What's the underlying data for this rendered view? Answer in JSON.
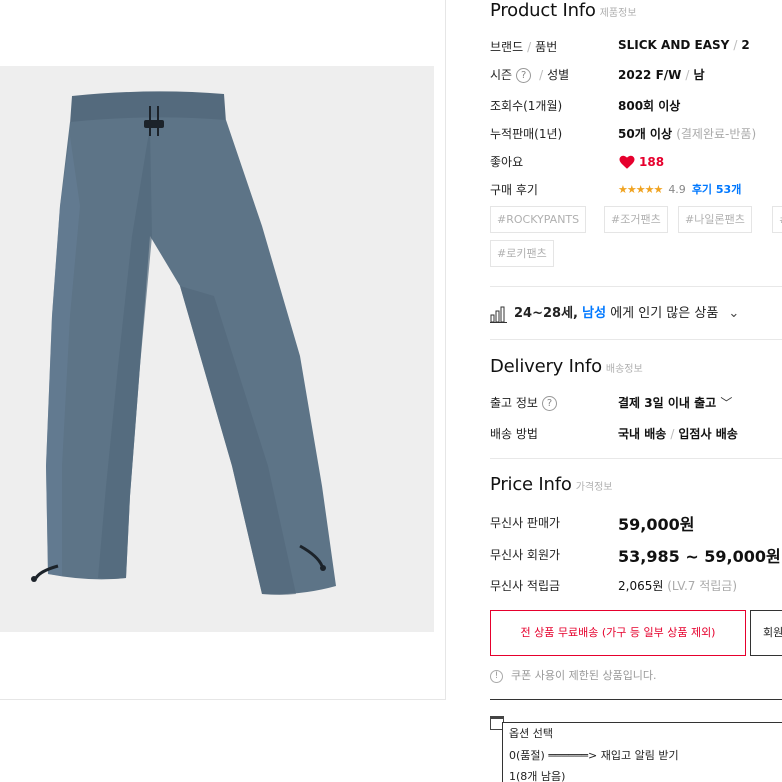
{
  "product_info": {
    "title": "Product Info",
    "subtitle": "제품정보",
    "brand_label": "브랜드",
    "model_label": "품번",
    "brand": "SLICK AND EASY",
    "model": "2",
    "season_label": "시즌",
    "gender_label": "성별",
    "season": "2022 F/W",
    "gender": "남",
    "views_label": "조회수(1개월)",
    "views": "800회 이상",
    "sales_label": "누적판매(1년)",
    "sales": "50개 이상",
    "sales_note": "(결제완료-반품)",
    "likes_label": "좋아요",
    "likes": "188",
    "reviews_label": "구매 후기",
    "stars": "★★★★★",
    "rating": "4.9",
    "review_count": "후기 53개"
  },
  "tags": [
    "#ROCKYPANTS",
    "#조거팬츠",
    "#나일론팬츠",
    "#",
    "#로키팬츠"
  ],
  "popular": {
    "age": "24~28세",
    "comma": ",",
    "gender": "남성",
    "text": "에게 인기 많은 상품"
  },
  "delivery_info": {
    "title": "Delivery Info",
    "subtitle": "배송정보",
    "shipping_label": "출고 정보",
    "shipping_value": "결제 3일 이내 출고",
    "method_label": "배송 방법",
    "method_domestic": "국내 배송",
    "method_vendor": "입점사 배송"
  },
  "price_info": {
    "title": "Price Info",
    "subtitle": "가격정보",
    "sale_label": "무신사 판매가",
    "sale_price": "59,000원",
    "member_label": "무신사 회원가",
    "member_price": "53,985 ~ 59,000원",
    "points_label": "무신사 적립금",
    "points": "2,065원",
    "points_note": "(LV.7 적립금)"
  },
  "free_shipping_button": "전 상품 무료배송 (가구 등 일부 상품 제외)",
  "member_button": "회원",
  "coupon_notice": "쿠폰 사용이 제한된 상품입니다.",
  "options": {
    "header": "옵션 선택",
    "item1": "0(품절) ══════> 재입고 알림 받기",
    "item2": "1(8개 남음)"
  },
  "colors": {
    "accent_red": "#e6002d",
    "link_blue": "#0078ff",
    "star_orange": "#f0a321",
    "pants": "#5b7285"
  }
}
